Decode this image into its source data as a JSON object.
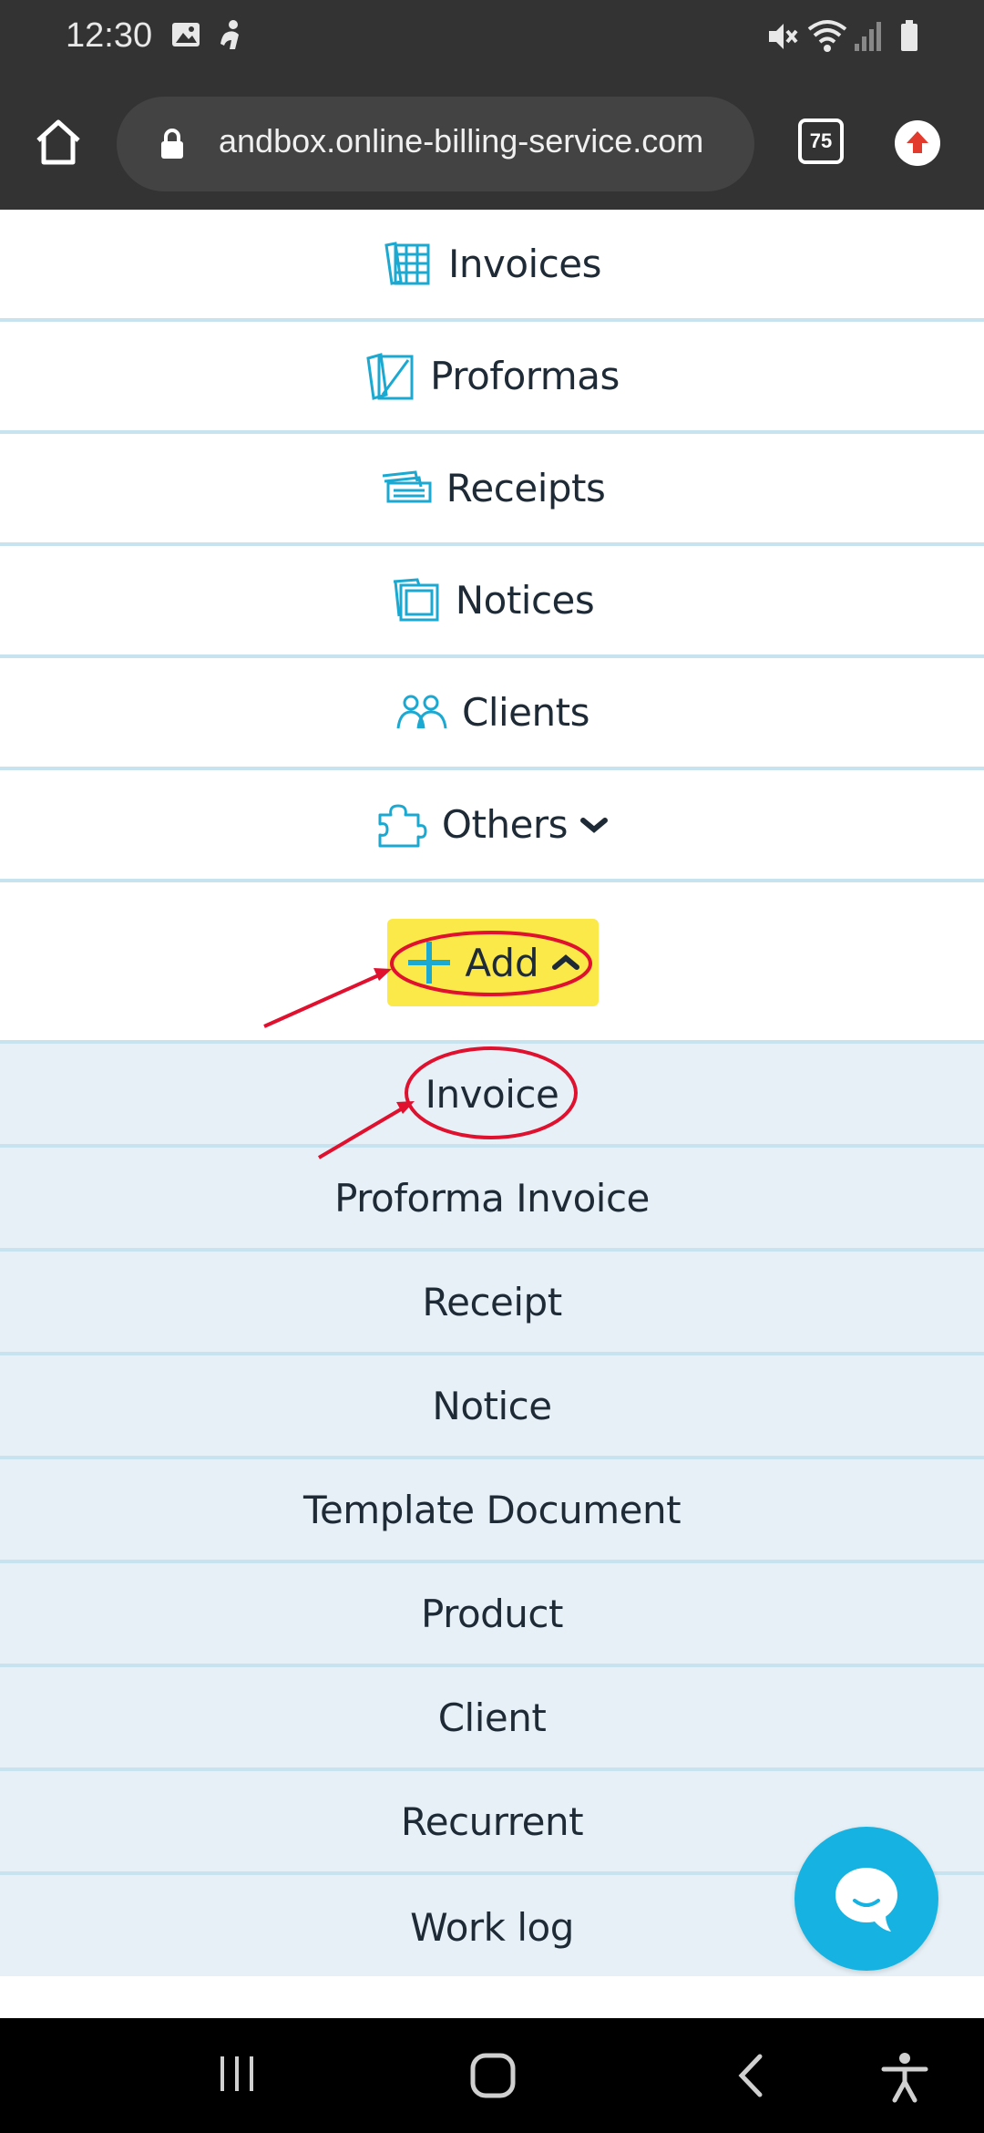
{
  "status_bar": {
    "time": "12:30",
    "left_icons": [
      "image-icon",
      "accessibility-notification-icon"
    ],
    "right_icons": [
      "mute-icon",
      "wifi-icon",
      "signal-icon",
      "battery-icon"
    ]
  },
  "browser": {
    "url": "andbox.online-billing-service.com",
    "tab_count": "75",
    "icons": [
      "home-icon",
      "lock-icon",
      "update-arrow-icon"
    ]
  },
  "menu": {
    "items": [
      {
        "label": "Invoices",
        "icon": "invoices-icon"
      },
      {
        "label": "Proformas",
        "icon": "proformas-icon"
      },
      {
        "label": "Receipts",
        "icon": "receipts-icon"
      },
      {
        "label": "Notices",
        "icon": "notices-icon"
      },
      {
        "label": "Clients",
        "icon": "clients-icon"
      },
      {
        "label": "Others",
        "icon": "puzzle-icon"
      }
    ],
    "add_label": "Add",
    "add_submenu": [
      "Invoice",
      "Proforma Invoice",
      "Receipt",
      "Notice",
      "Template Document",
      "Product",
      "Client",
      "Recurrent",
      "Work log"
    ]
  },
  "colors": {
    "accent": "#16b3e2",
    "highlight": "#fbe94a",
    "annotation": "#e0102f",
    "submenu_bg": "#e6f0f6",
    "divider": "#c6e3ef"
  }
}
